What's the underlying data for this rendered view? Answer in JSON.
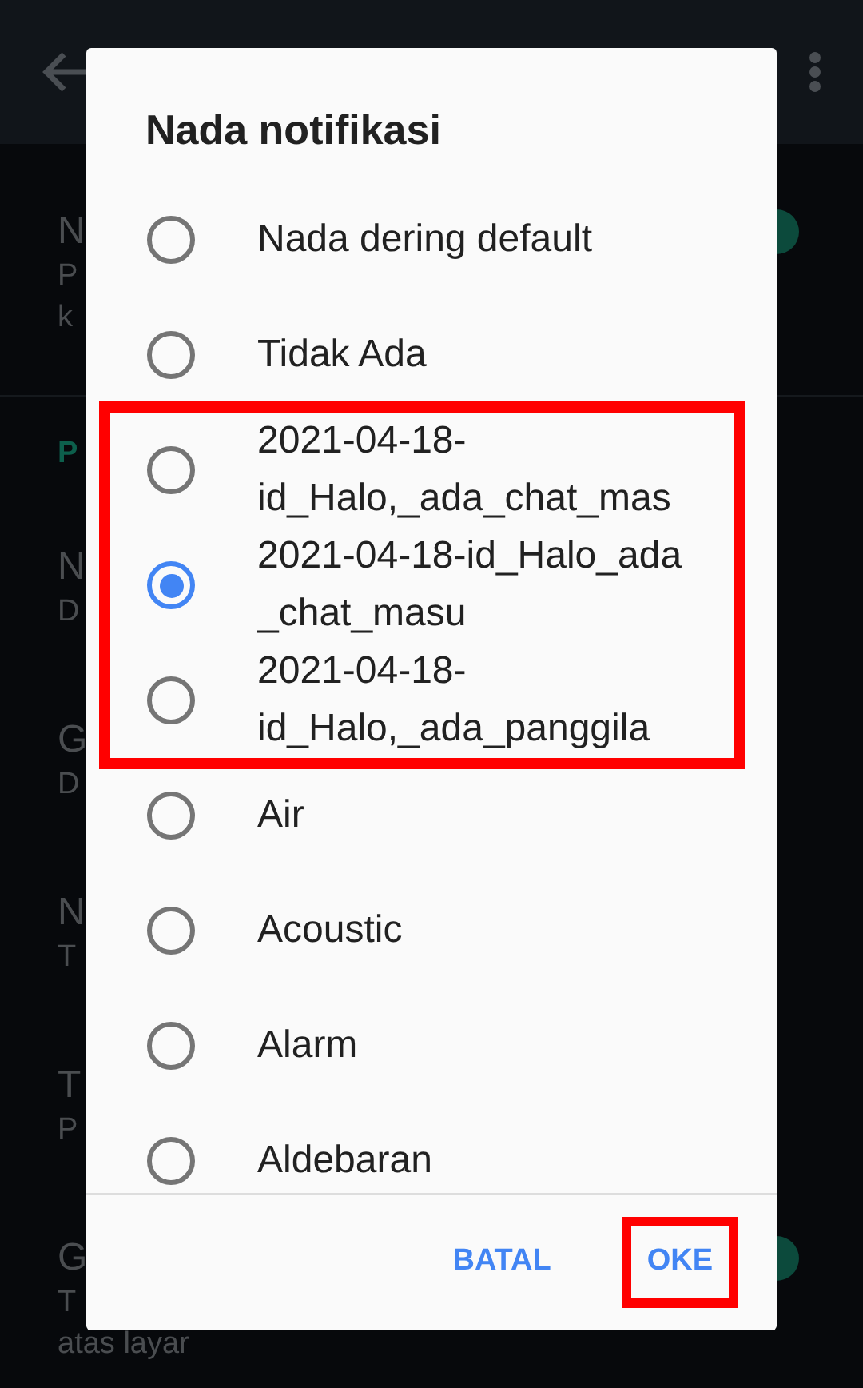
{
  "background": {
    "settings": [
      {
        "kind": "item",
        "lines": [
          "N",
          "P",
          "k"
        ],
        "toggle_on": true
      },
      {
        "kind": "header",
        "lines": [
          "P"
        ]
      },
      {
        "kind": "item",
        "lines": [
          "N",
          "D"
        ]
      },
      {
        "kind": "item",
        "lines": [
          "G",
          "D"
        ]
      },
      {
        "kind": "item",
        "lines": [
          "N",
          "T"
        ]
      },
      {
        "kind": "item",
        "lines": [
          "T",
          "P"
        ]
      },
      {
        "kind": "item",
        "lines": [
          "G",
          "T",
          "atas layar"
        ],
        "toggle_on": true
      }
    ]
  },
  "dialog": {
    "title": "Nada notifikasi",
    "options": [
      {
        "lines": [
          "Nada dering default"
        ],
        "selected": false,
        "highlighted": false
      },
      {
        "lines": [
          "Tidak Ada"
        ],
        "selected": false,
        "highlighted": false
      },
      {
        "lines": [
          "2021-04-18-",
          "id_Halo,_ada_chat_mas"
        ],
        "selected": false,
        "highlighted": true
      },
      {
        "lines": [
          "2021-04-18-id_Halo_ada",
          "_chat_masu"
        ],
        "selected": true,
        "highlighted": true
      },
      {
        "lines": [
          "2021-04-18-",
          "id_Halo,_ada_panggila"
        ],
        "selected": false,
        "highlighted": true
      },
      {
        "lines": [
          "Air"
        ],
        "selected": false,
        "highlighted": false
      },
      {
        "lines": [
          "Acoustic"
        ],
        "selected": false,
        "highlighted": false
      },
      {
        "lines": [
          "Alarm"
        ],
        "selected": false,
        "highlighted": false
      },
      {
        "lines": [
          "Aldebaran"
        ],
        "selected": false,
        "highlighted": false
      }
    ],
    "buttons": [
      {
        "label": "BATAL",
        "highlighted": false
      },
      {
        "label": "OKE",
        "highlighted": true
      }
    ]
  }
}
